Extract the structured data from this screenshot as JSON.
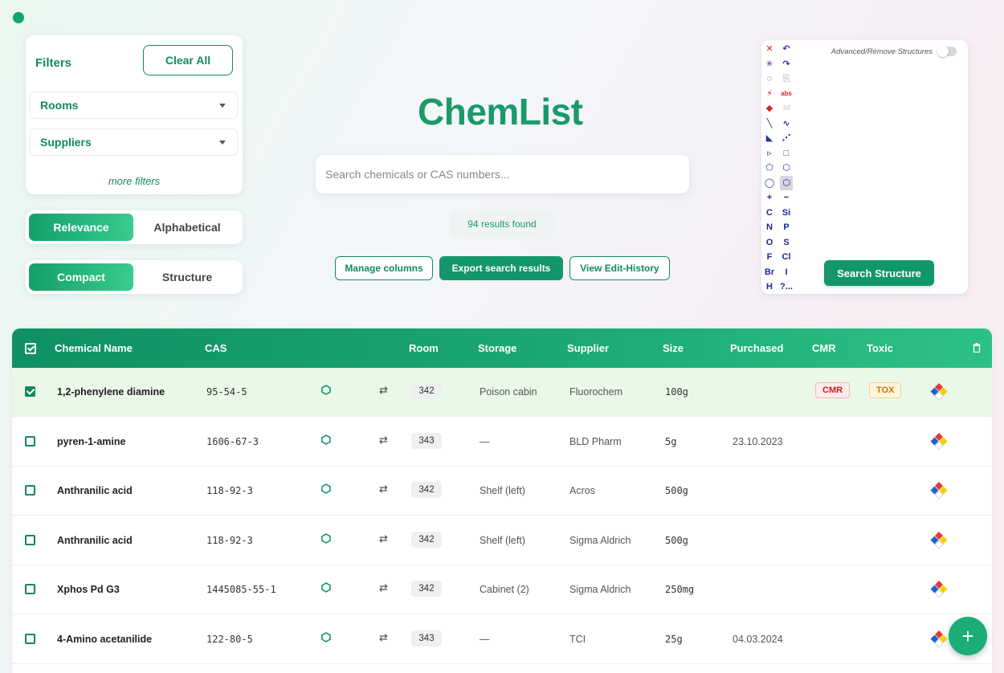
{
  "brand": "ChemList",
  "filters": {
    "title": "Filters",
    "clear_all": "Clear All",
    "rooms": "Rooms",
    "suppliers": "Suppliers",
    "more_filters": "more filters"
  },
  "sort": {
    "relevance": "Relevance",
    "alphabetical": "Alphabetical",
    "active": "Relevance"
  },
  "view": {
    "compact": "Compact",
    "structure": "Structure",
    "active": "Compact"
  },
  "search": {
    "placeholder": "Search chemicals or CAS numbers...",
    "value": ""
  },
  "results_text": "94 results found",
  "actions": {
    "manage_columns": "Manage columns",
    "export": "Export search results",
    "history": "View Edit-History"
  },
  "structure_editor": {
    "advanced_label": "Advanced/Remove Structures",
    "search_button": "Search Structure",
    "elements": [
      [
        "C",
        "Si"
      ],
      [
        "N",
        "P"
      ],
      [
        "O",
        "S"
      ],
      [
        "F",
        "Cl"
      ],
      [
        "Br",
        "I"
      ],
      [
        "H",
        "?..."
      ]
    ]
  },
  "table": {
    "headers": {
      "name": "Chemical Name",
      "cas": "CAS",
      "room": "Room",
      "storage": "Storage",
      "supplier": "Supplier",
      "size": "Size",
      "purchased": "Purchased",
      "cmr": "CMR",
      "toxic": "Toxic"
    },
    "rows": [
      {
        "checked": true,
        "name": "1,2-phenylene diamine",
        "cas": "95-54-5",
        "room": "342",
        "storage": "Poison cabin",
        "supplier": "Fluorochem",
        "size": "100g",
        "purchased": "",
        "cmr": "CMR",
        "toxic": "TOX"
      },
      {
        "checked": false,
        "name": "pyren-1-amine",
        "cas": "1606-67-3",
        "room": "343",
        "storage": "—",
        "supplier": "BLD Pharm",
        "size": "5g",
        "purchased": "23.10.2023",
        "cmr": "",
        "toxic": ""
      },
      {
        "checked": false,
        "name": "Anthranilic acid",
        "cas": "118-92-3",
        "room": "342",
        "storage": "Shelf (left)",
        "supplier": "Acros",
        "size": "500g",
        "purchased": "",
        "cmr": "",
        "toxic": ""
      },
      {
        "checked": false,
        "name": "Anthranilic acid",
        "cas": "118-92-3",
        "room": "342",
        "storage": "Shelf (left)",
        "supplier": "Sigma Aldrich",
        "size": "500g",
        "purchased": "",
        "cmr": "",
        "toxic": ""
      },
      {
        "checked": false,
        "name": "Xphos Pd G3",
        "cas": "1445085-55-1",
        "room": "342",
        "storage": "Cabinet (2)",
        "supplier": "Sigma Aldrich",
        "size": "250mg",
        "purchased": "",
        "cmr": "",
        "toxic": ""
      },
      {
        "checked": false,
        "name": "4-Amino acetanilide",
        "cas": "122-80-5",
        "room": "343",
        "storage": "—",
        "supplier": "TCI",
        "size": "25g",
        "purchased": "04.03.2024",
        "cmr": "",
        "toxic": ""
      }
    ]
  },
  "fab_label": "+",
  "colors": {
    "accent": "#13976a",
    "brand": "#1a9a68",
    "cmr": "#d11c1c",
    "tox": "#c57a00"
  }
}
